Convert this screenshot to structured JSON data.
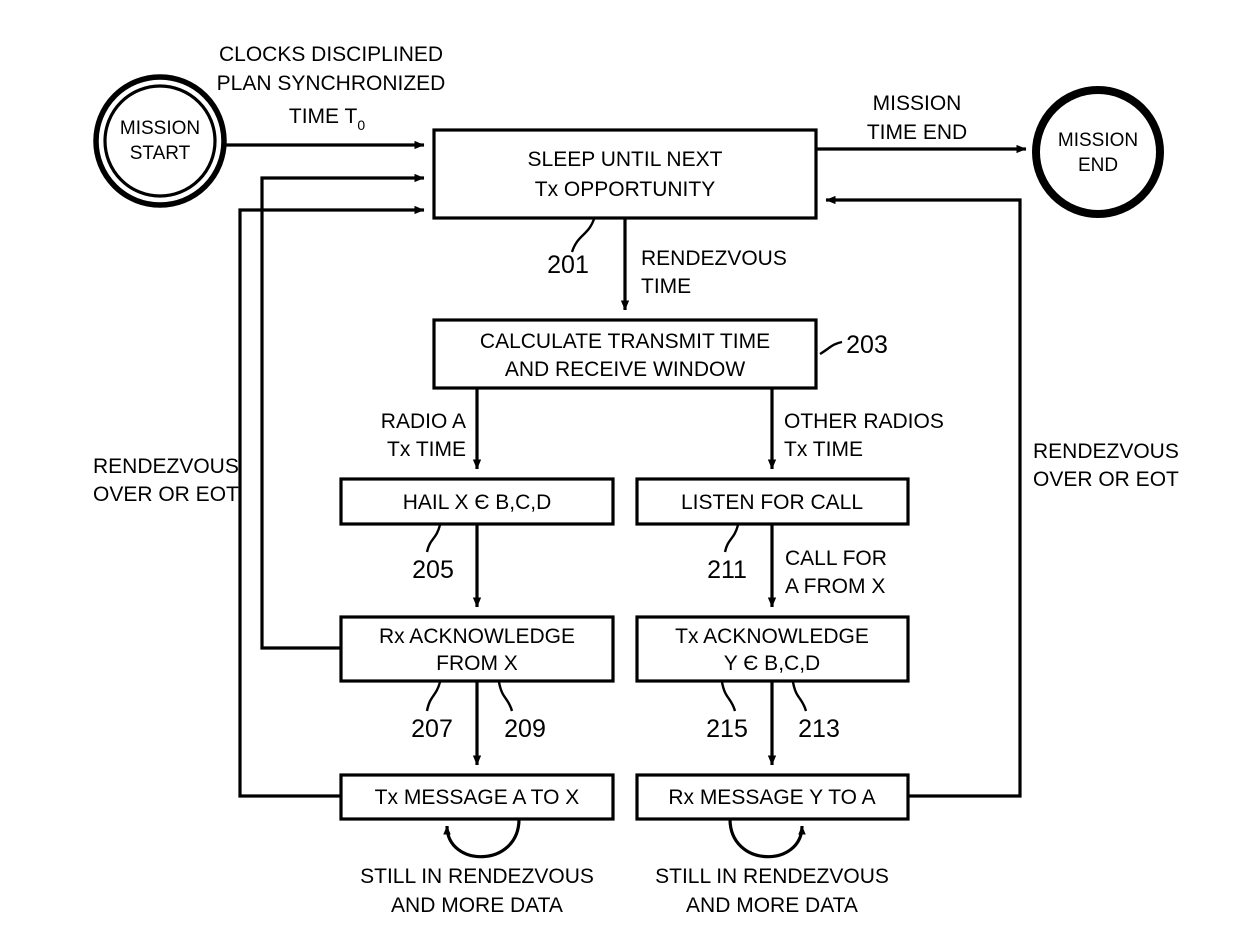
{
  "diagram": {
    "title": "Radio rendezvous mission flowchart",
    "stroke_color": "#000000",
    "background_color": "#ffffff"
  },
  "terminators": {
    "start": {
      "line1": "MISSION",
      "line2": "START"
    },
    "end": {
      "line1": "MISSION",
      "line2": "END"
    }
  },
  "boxes": {
    "sleep": {
      "line1": "SLEEP UNTIL NEXT",
      "line2": "Tx OPPORTUNITY",
      "ref": "201"
    },
    "calculate": {
      "line1": "CALCULATE TRANSMIT TIME",
      "line2": "AND RECEIVE WINDOW",
      "ref": "203"
    },
    "hail": {
      "line1": "HAIL X Є B,C,D",
      "ref": "205"
    },
    "listen": {
      "line1": "LISTEN FOR CALL",
      "ref": "211"
    },
    "rx_ack": {
      "line1": "Rx ACKNOWLEDGE",
      "line2": "FROM X",
      "ref": "207",
      "ref2": "209"
    },
    "tx_ack": {
      "line1": "Tx ACKNOWLEDGE",
      "line2": "Y Є B,C,D",
      "ref": "215",
      "ref2": "213"
    },
    "tx_msg": {
      "line1": "Tx MESSAGE A TO X"
    },
    "rx_msg": {
      "line1": "Rx MESSAGE Y TO A"
    }
  },
  "edge_labels": {
    "start_to_sleep_l1": "CLOCKS DISCIPLINED",
    "start_to_sleep_l2": "PLAN SYNCHRONIZED",
    "start_to_sleep_l3": "TIME T",
    "start_to_sleep_l3_sub": "0",
    "mission_time_end_l1": "MISSION",
    "mission_time_end_l2": "TIME END",
    "rendezvous_time_l1": "RENDEZVOUS",
    "rendezvous_time_l2": "TIME",
    "radio_a_l1": "RADIO A",
    "radio_a_l2": "Tx TIME",
    "other_radios_l1": "OTHER RADIOS",
    "other_radios_l2": "Tx TIME",
    "call_for_l1": "CALL FOR",
    "call_for_l2": "A FROM X",
    "left_return_l1": "RENDEZVOUS",
    "left_return_l2": "OVER OR EOT",
    "right_return_l1": "RENDEZVOUS",
    "right_return_l2": "OVER OR EOT",
    "loop_left_l1": "STILL IN RENDEZVOUS",
    "loop_left_l2": "AND MORE DATA",
    "loop_right_l1": "STILL IN RENDEZVOUS",
    "loop_right_l2": "AND MORE DATA"
  }
}
